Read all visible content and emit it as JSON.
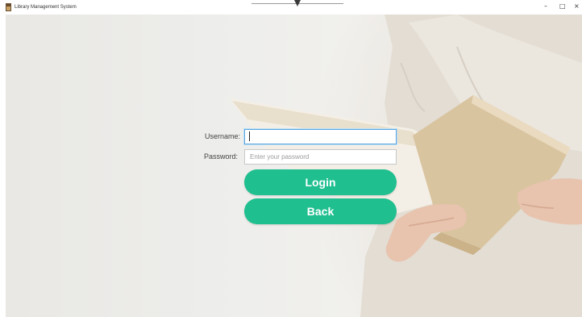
{
  "window": {
    "title": "Library Management System",
    "controls": {
      "minimize": "–",
      "maximize": "□",
      "close": "×"
    }
  },
  "login_form": {
    "username_label": "Username:",
    "username_value": "",
    "password_label": "Password:",
    "password_placeholder": "Enter your password",
    "login_button": "Login",
    "back_button": "Back"
  },
  "colors": {
    "button": "#1fbf8f",
    "button_text": "#ffffff",
    "focus_border": "#5aa4dd"
  },
  "icons": [
    "book-icon",
    "minimize-icon",
    "maximize-icon",
    "close-icon",
    "drag-arrow-icon"
  ]
}
